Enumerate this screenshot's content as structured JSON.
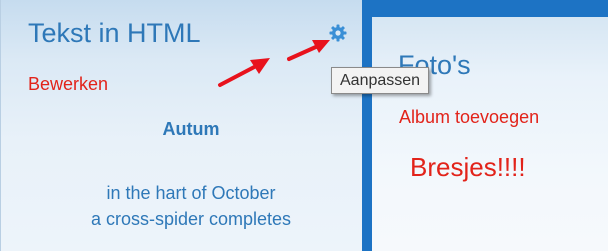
{
  "left_widget": {
    "title": "Tekst in HTML",
    "edit_link": "Bewerken",
    "settings_icon": "gear-icon",
    "content": {
      "heading": "Autum",
      "lines": [
        "in the hart of October",
        "a cross-spider completes"
      ]
    }
  },
  "right_widget": {
    "title": "Foto's",
    "add_album_link": "Album toevoegen",
    "note": "Bresjes!!!!"
  },
  "tooltip": {
    "text": "Aanpassen"
  },
  "colors": {
    "accent_blue": "#1d73c4",
    "title_blue": "#2e78b8",
    "link_red": "#e2231a",
    "arrow_red": "#e8121c"
  }
}
